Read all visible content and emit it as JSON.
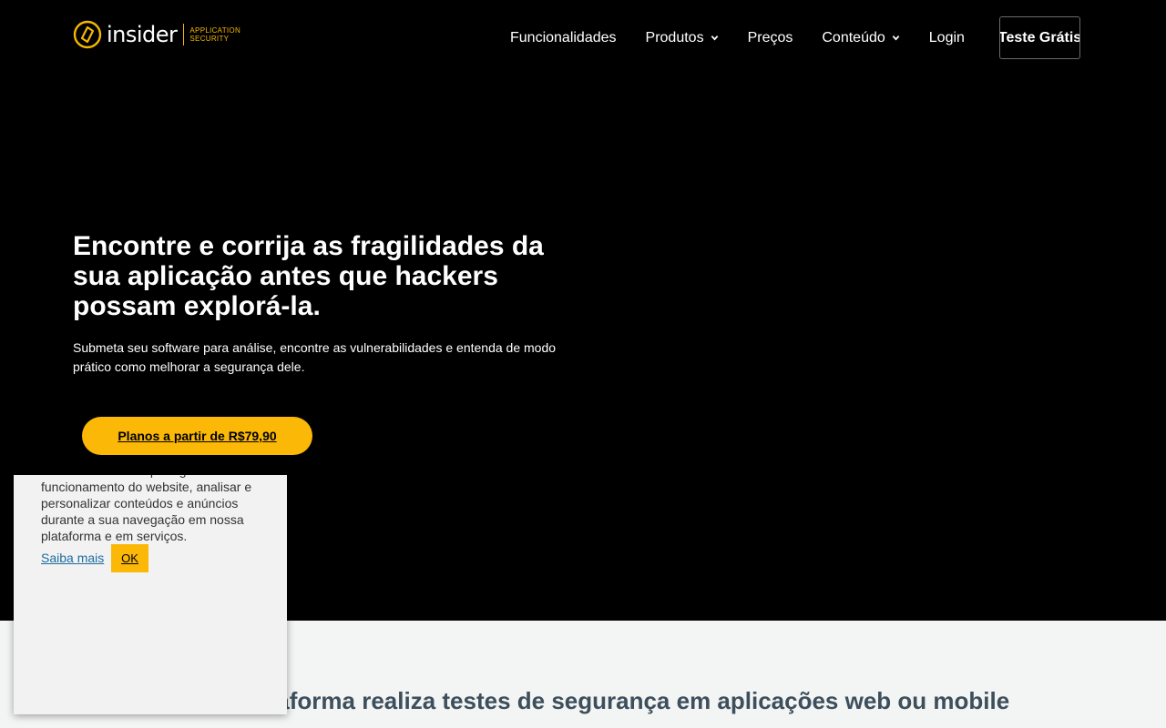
{
  "brand": {
    "name": "insider",
    "sub_line1": "APPLICATION",
    "sub_line2": "SECURITY",
    "accent_color": "#fbb806"
  },
  "nav": {
    "items": [
      {
        "label": "Funcionalidades",
        "dropdown": false
      },
      {
        "label": "Produtos",
        "dropdown": true
      },
      {
        "label": "Preços",
        "dropdown": false
      },
      {
        "label": "Conteúdo",
        "dropdown": true
      },
      {
        "label": "Login",
        "dropdown": false
      }
    ],
    "cta_label": "Teste Grátis"
  },
  "hero": {
    "title": "Encontre e corrija as fragilidades da sua aplicação antes que hackers possam explorá-la.",
    "subtitle": "Submeta seu software para análise, encontre as vulnerabilidades e entenda de modo prático como melhorar a segurança dele.",
    "button_label": "Planos a partir de R$79,90"
  },
  "section2": {
    "title": "Nossa plataforma realiza testes de segurança em aplicações web ou mobile"
  },
  "cookie_banner": {
    "text": "Utilizamos cookies para garantir o funcionamento do website, analisar e personalizar conteúdos e anúncios durante a sua navegação em nossa plataforma e em serviços.",
    "learn_more_label": "Saiba mais",
    "ok_label": "OK"
  }
}
